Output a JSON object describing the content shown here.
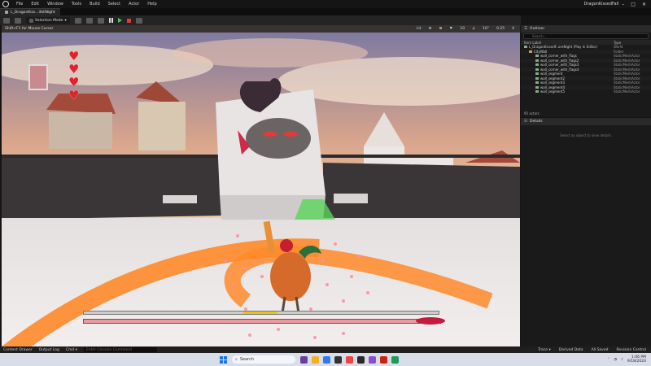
{
  "app": {
    "menu": [
      "File",
      "Edit",
      "Window",
      "Tools",
      "Build",
      "Select",
      "Actor",
      "Help"
    ],
    "project_name": "DragonKissedFall",
    "window_controls": [
      "–",
      "□",
      "✕"
    ]
  },
  "tab": {
    "label": "L_DragonKiss...ifallNight"
  },
  "toolbar": {
    "mode_label": "Selection Mode"
  },
  "viewport": {
    "header_text": "Shift+F1 for Mouse Cursor",
    "controls": [
      "Lit",
      "⚙",
      "⊞",
      "⚑",
      "10",
      "∠",
      "10°",
      "0.25",
      "4"
    ]
  },
  "hud": {
    "hearts": [
      "♥",
      "♥",
      "♥",
      "♥"
    ]
  },
  "outliner": {
    "title": "Outliner",
    "search_placeholder": "Search...",
    "columns": {
      "label": "Item Label",
      "type": "Type"
    },
    "rows": [
      {
        "label": "L_DragonKissedF..oreNight (Play In Editor)",
        "type": "World"
      },
      {
        "label": "CityWall",
        "type": "Folder"
      },
      {
        "label": "wall_corner_with_flags",
        "type": "StaticMeshActor"
      },
      {
        "label": "wall_corner_with_flags2",
        "type": "StaticMeshActor"
      },
      {
        "label": "wall_corner_with_flags3",
        "type": "StaticMeshActor"
      },
      {
        "label": "wall_corner_with_flags4",
        "type": "StaticMeshActor"
      },
      {
        "label": "wall_segment",
        "type": "StaticMeshActor"
      },
      {
        "label": "wall_segment2",
        "type": "StaticMeshActor"
      },
      {
        "label": "wall_segment3",
        "type": "StaticMeshActor"
      },
      {
        "label": "wall_segment4",
        "type": "StaticMeshActor"
      },
      {
        "label": "wall_segment5",
        "type": "StaticMeshActor"
      }
    ],
    "count": "95 actors"
  },
  "details": {
    "title": "Details",
    "hint": "Select an object to view details."
  },
  "statusbar": {
    "items": [
      "Content Drawer",
      "Output Log",
      "Cmd ▾"
    ],
    "cmd_placeholder": "Enter Console Command",
    "right": [
      "Trace ▾",
      "Derived Data",
      "All Saved",
      "Revision Control"
    ]
  },
  "taskbar": {
    "search": "Search",
    "time": "1:06 PM",
    "date": "9/18/2024"
  },
  "colors": {
    "accent_green": "#5ac15a",
    "stop_red": "#e03b3b",
    "heart_red": "#e0242c",
    "windows_blue": "#1a73e8"
  }
}
